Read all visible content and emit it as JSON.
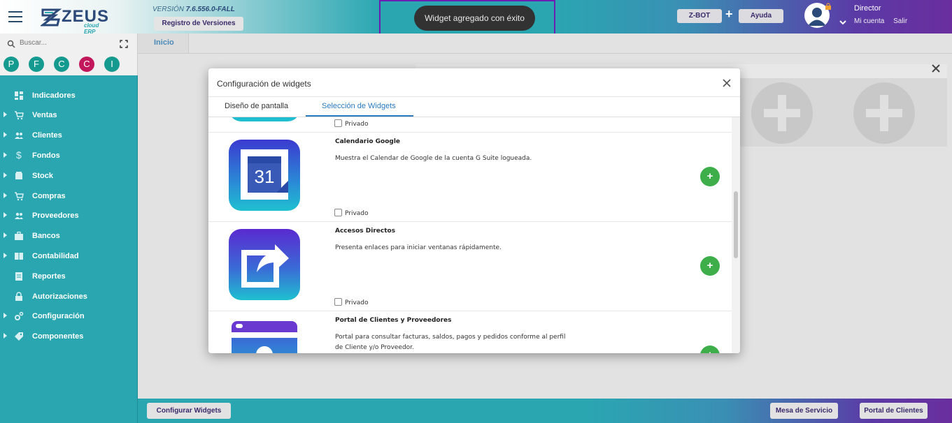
{
  "header": {
    "logo_text": "ZEUS",
    "logo_sub": "cloud ERP",
    "version_prefix": "VERSIÓN",
    "version_number": "7.6.556.0-FALL",
    "registro_label": "Registro de Versiones",
    "toast_message": "Widget agregado con éxito",
    "zbot_label": "Z-BOT",
    "plus_label": "+",
    "ayuda_label": "Ayuda",
    "user_name": "Director",
    "mi_cuenta": "Mi cuenta",
    "salir": "Salir"
  },
  "sidebar": {
    "search_placeholder": "Buscar...",
    "quick_circles": [
      "P",
      "F",
      "C",
      "C",
      "I"
    ],
    "items": [
      {
        "label": "Indicadores",
        "icon": "dashboard-icon",
        "expandable": false
      },
      {
        "label": "Ventas",
        "icon": "cart-icon",
        "expandable": true
      },
      {
        "label": "Clientes",
        "icon": "people-icon",
        "expandable": true
      },
      {
        "label": "Fondos",
        "icon": "dollar-icon",
        "expandable": true
      },
      {
        "label": "Stock",
        "icon": "stock-icon",
        "expandable": true
      },
      {
        "label": "Compras",
        "icon": "cart-add-icon",
        "expandable": true
      },
      {
        "label": "Proveedores",
        "icon": "people-icon",
        "expandable": true
      },
      {
        "label": "Bancos",
        "icon": "briefcase-icon",
        "expandable": true
      },
      {
        "label": "Contabilidad",
        "icon": "book-icon",
        "expandable": true
      },
      {
        "label": "Reportes",
        "icon": "report-icon",
        "expandable": false
      },
      {
        "label": "Autorizaciones",
        "icon": "lock-icon",
        "expandable": false
      },
      {
        "label": "Configuración",
        "icon": "gears-icon",
        "expandable": true
      },
      {
        "label": "Componentes",
        "icon": "tag-icon",
        "expandable": true
      }
    ]
  },
  "main": {
    "tab_inicio": "Inicio"
  },
  "footer": {
    "configurar": "Configurar Widgets",
    "mesa": "Mesa de Servicio",
    "portal": "Portal de Clientes"
  },
  "modal": {
    "title": "Configuración de widgets",
    "tabs": [
      "Diseño de pantalla",
      "Selección de Widgets"
    ],
    "private_label": "Privado",
    "add_label": "+",
    "widgets": [
      {
        "title": "Calendario Google",
        "description": "Muestra el Calendar de Google de la cuenta G Suite logueada.",
        "icon": "google-calendar-icon",
        "icon_text": "31"
      },
      {
        "title": "Accesos Directos",
        "description": "Presenta enlaces para iniciar ventanas rápidamente.",
        "icon": "shortcut-share-icon"
      },
      {
        "title": "Portal de Clientes y Proveedores",
        "description": "Portal para consultar facturas, saldos, pagos y pedidos conforme al perfil de Cliente y/o Proveedor.",
        "icon": "portal-icon"
      }
    ]
  },
  "colors": {
    "teal": "#2aa6b1",
    "purple": "#6a2e9e",
    "green_add": "#3dae4a",
    "link_blue": "#2a7ac0",
    "pink_circle": "#c2185b"
  }
}
